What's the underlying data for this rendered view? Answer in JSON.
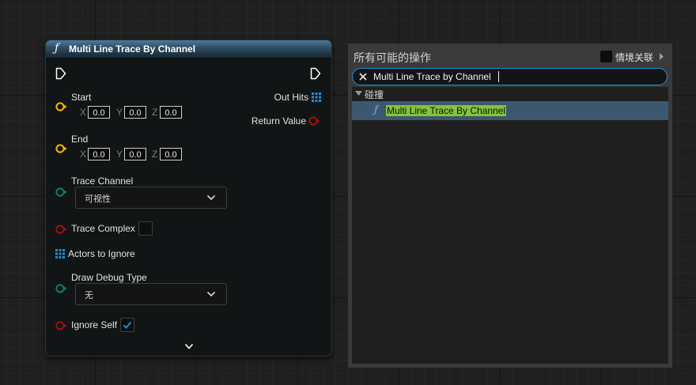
{
  "node": {
    "title": "Multi Line Trace By Channel",
    "fn_glyph": "ƒ",
    "inputs": {
      "start": {
        "label": "Start",
        "x": "0.0",
        "y": "0.0",
        "z": "0.0"
      },
      "end": {
        "label": "End",
        "x": "0.0",
        "y": "0.0",
        "z": "0.0"
      },
      "axis": {
        "x": "X",
        "y": "Y",
        "z": "Z"
      },
      "trace_channel": {
        "label": "Trace Channel",
        "value": "可视性"
      },
      "trace_complex": {
        "label": "Trace Complex",
        "checked": false
      },
      "actors_to_ignore": {
        "label": "Actors to Ignore"
      },
      "draw_debug_type": {
        "label": "Draw Debug Type",
        "value": "无"
      },
      "ignore_self": {
        "label": "Ignore Self",
        "checked": true
      }
    },
    "outputs": {
      "out_hits": {
        "label": "Out Hits"
      },
      "return_value": {
        "label": "Return Value"
      }
    },
    "expand_icon": "chevron-down-icon"
  },
  "action_menu": {
    "title": "所有可能的操作",
    "context_sensitive_label": "情境关联",
    "context_sensitive_checked": false,
    "search_value": "Multi Line Trace by Channel",
    "category": "碰撞",
    "results": [
      {
        "fn_glyph": "ƒ",
        "label": "Multi Line Trace By Channel",
        "selected": true
      }
    ]
  },
  "colors": {
    "exec_pin": "#ffffff",
    "vector_pin": "#f0b400",
    "byte_pin": "#0c7a6c",
    "bool_pin": "#9a1010",
    "array_pin": "#1e8fd6",
    "selection": "#3c5770",
    "highlight": "#83c43a",
    "focus_border": "#1e8fd6"
  }
}
